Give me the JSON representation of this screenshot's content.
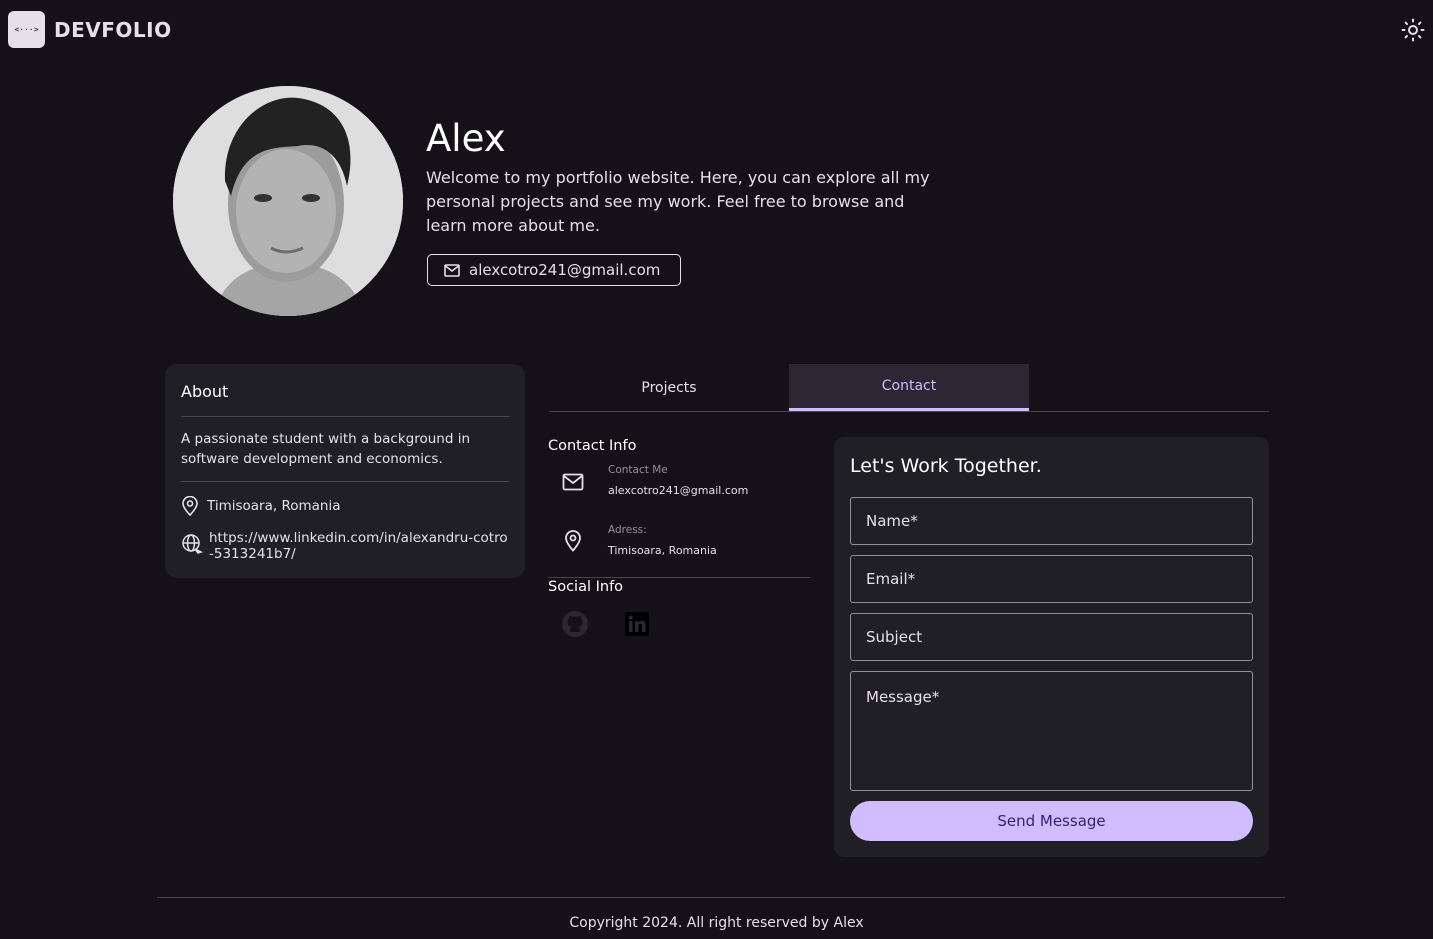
{
  "header": {
    "logo_glyph": "<···>",
    "brand": "DEVFOLIO"
  },
  "hero": {
    "name": "Alex",
    "intro": "Welcome to my portfolio website. Here, you can explore all my personal projects and see my work. Feel free to browse and learn more about me.",
    "email": "alexcotro241@gmail.com"
  },
  "about": {
    "title": "About",
    "description": "A passionate student with a background in software development and economics.",
    "location": "Timisoara, Romania",
    "link": "https://www.linkedin.com/in/alexandru-cotro-5313241b7/"
  },
  "tabs": {
    "projects": "Projects",
    "contact": "Contact",
    "active": "Contact"
  },
  "contact_info": {
    "title": "Contact Info",
    "email_label": "Contact Me",
    "email_value": "alexcotro241@gmail.com",
    "address_label": "Adress:",
    "address_value": "Timisoara, Romania"
  },
  "social": {
    "title": "Social Info",
    "icons": [
      "github-icon",
      "linkedin-icon"
    ]
  },
  "form": {
    "title": "Let's Work Together.",
    "name_placeholder": "Name*",
    "email_placeholder": "Email*",
    "subject_placeholder": "Subject",
    "message_placeholder": "Message*",
    "send_label": "Send Message"
  },
  "footer": {
    "copyright": "Copyright 2024. All right reserved by Alex"
  },
  "colors": {
    "background": "#141218",
    "card": "#211f26",
    "accent": "#d0bcff",
    "on_accent": "#381e72",
    "divider": "#49454f"
  }
}
